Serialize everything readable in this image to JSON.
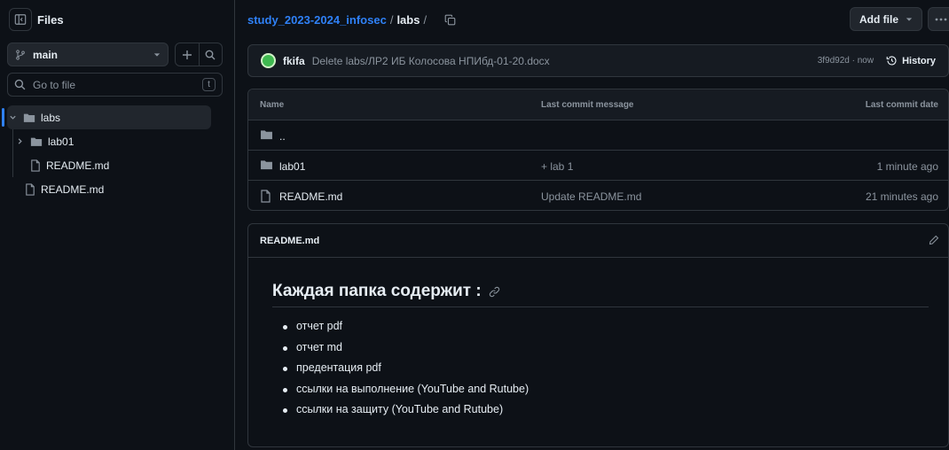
{
  "sidebar": {
    "title": "Files",
    "branch": "main",
    "search_placeholder": "Go to file",
    "search_shortcut": "t",
    "tree": [
      {
        "label": "labs",
        "type": "folder",
        "expanded": true,
        "selected": true
      },
      {
        "label": "lab01",
        "type": "folder",
        "expanded": false
      },
      {
        "label": "README.md",
        "type": "file"
      },
      {
        "label": "README.md",
        "type": "file"
      }
    ]
  },
  "breadcrumb": {
    "repo": "study_2023-2024_infosec",
    "sep1": "/",
    "current": "labs",
    "sep2": "/"
  },
  "toolbar": {
    "add_file_label": "Add file"
  },
  "latest_commit": {
    "author": "fkifa",
    "message": "Delete labs/ЛР2 ИБ Колосова НПИбд-01-20.docx",
    "sha_time": "3f9d92d · now",
    "history_label": "History"
  },
  "file_table": {
    "headers": {
      "name": "Name",
      "message": "Last commit message",
      "date": "Last commit date"
    },
    "rows": [
      {
        "name": "..",
        "type": "folder",
        "message": "",
        "date": ""
      },
      {
        "name": "lab01",
        "type": "folder",
        "message": "+ lab 1",
        "date": "1 minute ago"
      },
      {
        "name": "README.md",
        "type": "file",
        "message": "Update README.md",
        "date": "21 minutes ago"
      }
    ]
  },
  "readme": {
    "title": "README.md",
    "heading": "Каждая папка содержит :",
    "items": [
      "отчет pdf",
      "отчет md",
      "предентация pdf",
      "ссылки на выполнение (YouTube and Rutube)",
      "ссылки на защиту (YouTube and Rutube)"
    ]
  },
  "colors": {
    "background": "#0d1117",
    "border": "#30363d",
    "accent": "#2f81f7",
    "muted_text": "#8b949e"
  }
}
